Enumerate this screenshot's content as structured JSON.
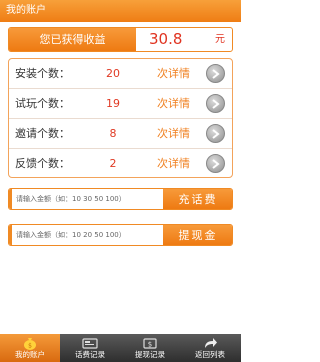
{
  "header": {
    "title": "我的账户"
  },
  "earnings": {
    "label": "您已获得收益",
    "value": "30.8",
    "unit": "元"
  },
  "stats": [
    {
      "label": "安装个数：",
      "count": "20",
      "link": "次详情"
    },
    {
      "label": "试玩个数：",
      "count": "19",
      "link": "次详情"
    },
    {
      "label": "邀请个数：",
      "count": "8",
      "link": "次详情"
    },
    {
      "label": "反馈个数：",
      "count": "2",
      "link": "次详情"
    }
  ],
  "recharge": {
    "placeholder": "请输入金额（如：10 30 50 100）",
    "button": "充话费"
  },
  "withdraw": {
    "placeholder": "请输入金额（如：10 20 50 100）",
    "button": "提现金"
  },
  "tabs": [
    {
      "label": "我的账户",
      "icon": "money-bag-icon"
    },
    {
      "label": "话费记录",
      "icon": "phone-card-icon"
    },
    {
      "label": "提现记录",
      "icon": "wallet-icon"
    },
    {
      "label": "返回列表",
      "icon": "return-arrow-icon"
    }
  ],
  "colors": {
    "accent": "#f08a24",
    "value": "#e03320"
  }
}
